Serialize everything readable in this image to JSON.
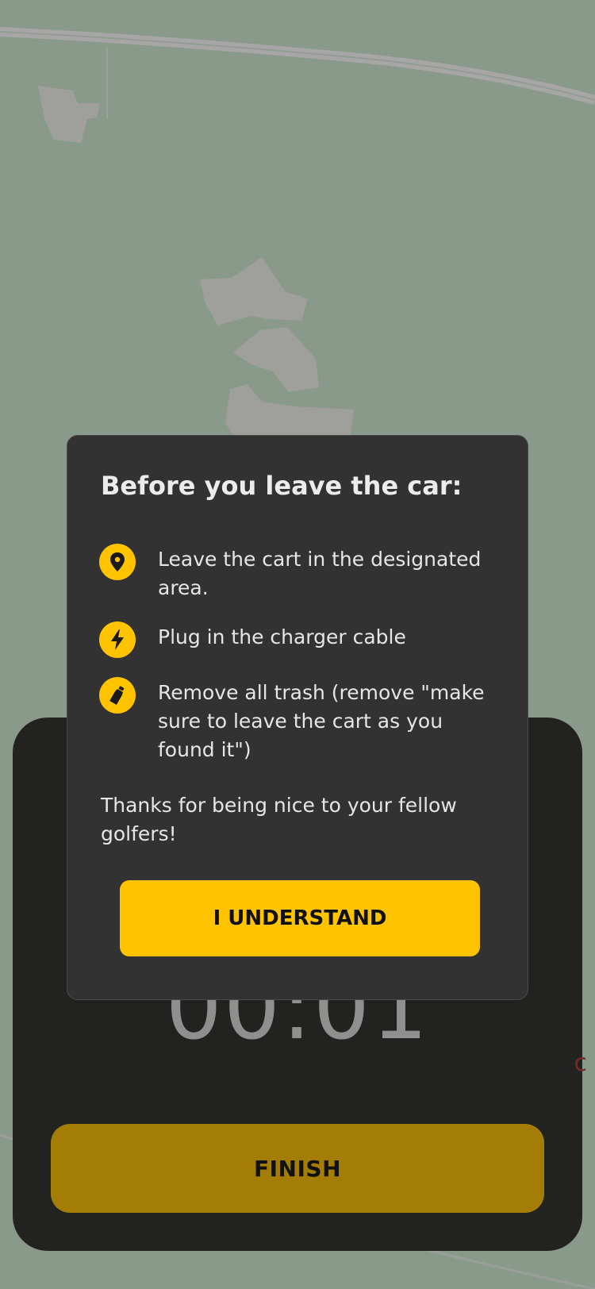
{
  "colors": {
    "map_background": "#8a9a8a",
    "accent_yellow": "#ffc300",
    "dialog_background": "#323232",
    "sheet_background": "#222220",
    "finish_button": "#a37d06"
  },
  "dialog": {
    "title": "Before you leave the car:",
    "items": [
      {
        "icon": "location-pin-icon",
        "text": "Leave the cart in the designated area."
      },
      {
        "icon": "lightning-icon",
        "text": "Plug in the charger cable"
      },
      {
        "icon": "bottle-icon",
        "text": "Remove all trash (remove \"make sure to leave the cart as you found it\")"
      }
    ],
    "thanks": "Thanks for being nice to your fellow golfers!",
    "understand_label": "I UNDERSTAND"
  },
  "sheet": {
    "timer": "00:01",
    "finish_label": "FINISH"
  }
}
